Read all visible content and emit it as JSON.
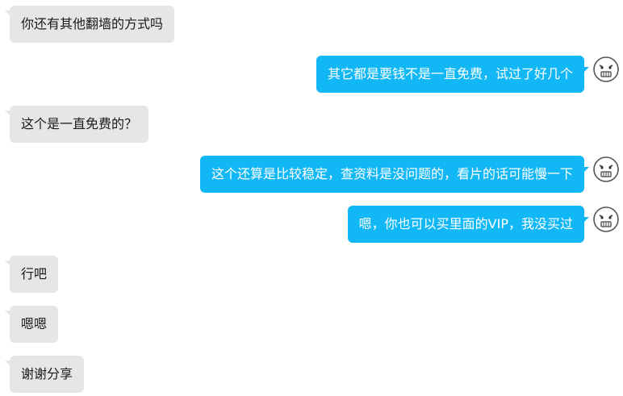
{
  "messages": [
    {
      "side": "incoming",
      "text": "你还有其他翻墙的方式吗"
    },
    {
      "side": "outgoing",
      "text": "其它都是要钱不是一直免费，试过了好几个",
      "avatar_icon": "grimace-face-icon"
    },
    {
      "side": "incoming",
      "text": "这个是一直免费的？"
    },
    {
      "side": "outgoing",
      "text": "这个还算是比较稳定，查资料是没问题的，看片的话可能慢一下",
      "avatar_icon": "grimace-face-icon"
    },
    {
      "side": "outgoing",
      "text": "嗯，你也可以买里面的VIP，我没买过",
      "avatar_icon": "grimace-face-icon"
    },
    {
      "side": "incoming",
      "text": "行吧"
    },
    {
      "side": "incoming",
      "text": "嗯嗯"
    },
    {
      "side": "incoming",
      "text": "谢谢分享"
    }
  ],
  "colors": {
    "incoming_bubble": "#e6e6e6",
    "outgoing_bubble": "#12b7f5",
    "incoming_text": "#1a1a1a",
    "outgoing_text": "#ffffff"
  }
}
